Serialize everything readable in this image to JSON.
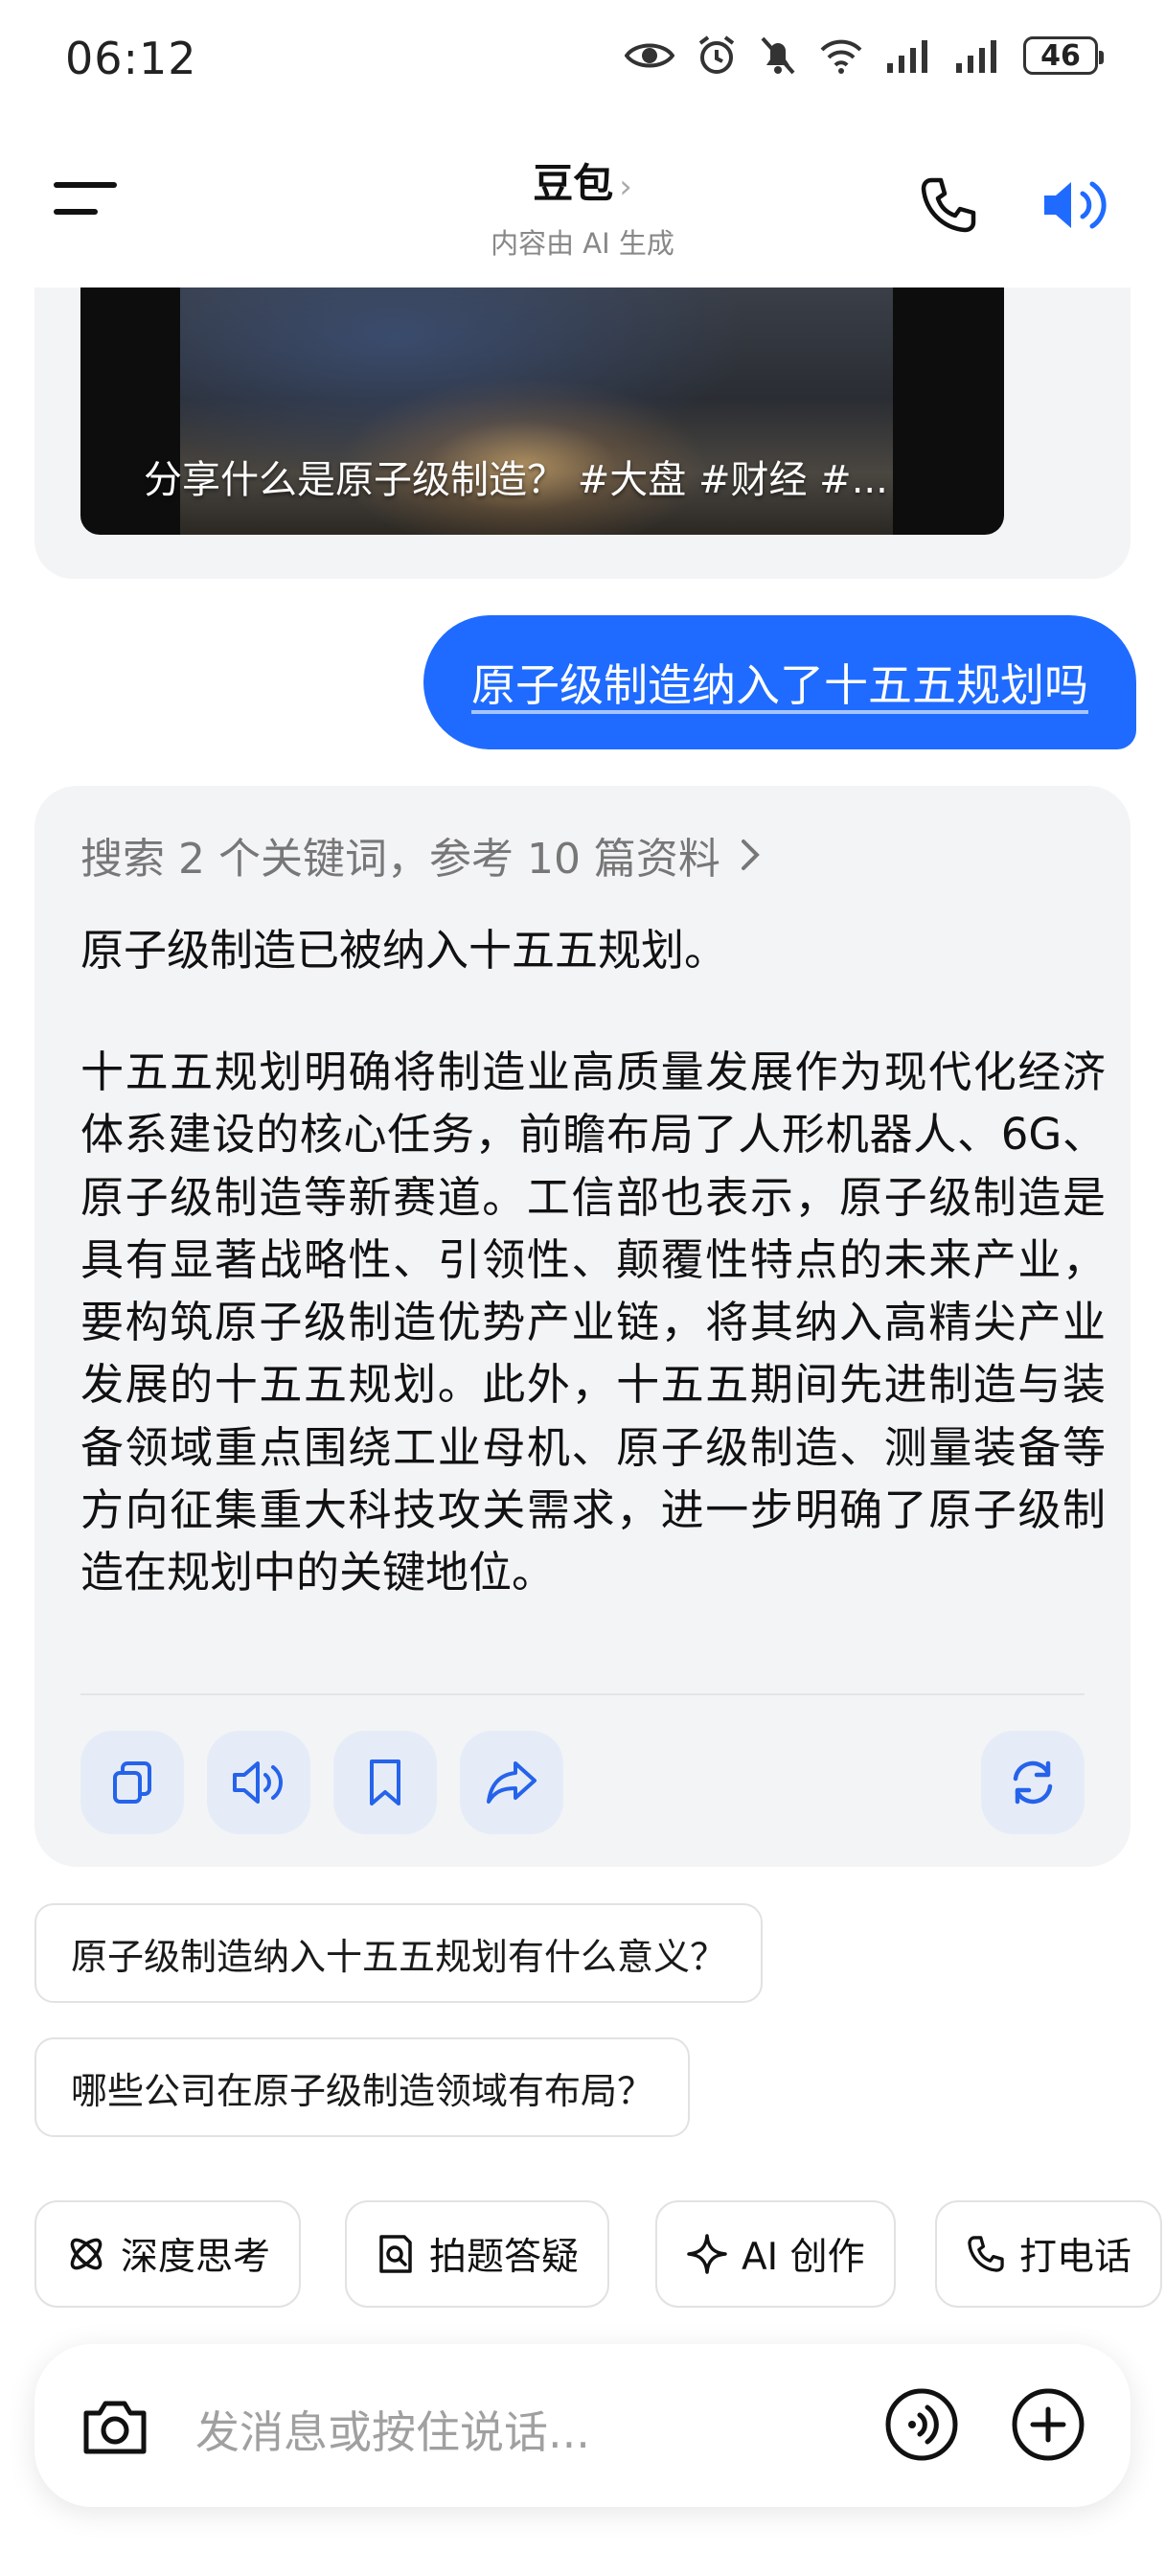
{
  "status_bar": {
    "time": "06:12",
    "battery": "46"
  },
  "header": {
    "title": "豆包",
    "title_chevron": "›",
    "subtitle": "内容由 AI 生成"
  },
  "video": {
    "caption": "分享什么是原子级制造？ #大盘 #财经 #..."
  },
  "user_message": "原子级制造纳入了十五五规划吗",
  "answer": {
    "search_summary": "搜索 2 个关键词，参考 10 篇资料",
    "lead": "原子级制造已被纳入十五五规划。",
    "body": "十五五规划明确将制造业高质量发展作为现代化经济体系建设的核心任务，前瞻布局了人形机器人、6G、原子级制造等新赛道。工信部也表示，原子级制造是具有显著战略性、引领性、颠覆性特点的未来产业，要构筑原子级制造优势产业链，将其纳入高精尖产业发展的十五五规划。此外，十五五期间先进制造与装备领域重点围绕工业母机、原子级制造、测量装备等方向征集重大科技攻关需求，进一步明确了原子级制造在规划中的关键地位。"
  },
  "suggestions": [
    "原子级制造纳入十五五规划有什么意义？",
    "哪些公司在原子级制造领域有布局？"
  ],
  "tools": [
    {
      "label": "深度思考",
      "icon": "deep-think-icon"
    },
    {
      "label": "拍题答疑",
      "icon": "photo-question-icon"
    },
    {
      "label": "AI 创作",
      "icon": "sparkle-icon"
    },
    {
      "label": "打电话",
      "icon": "phone-icon"
    }
  ],
  "input": {
    "placeholder": "发消息或按住说话..."
  },
  "colors": {
    "accent": "#1f6bff",
    "card_bg": "#f3f4f6",
    "action_bg": "#e6ecf7"
  }
}
